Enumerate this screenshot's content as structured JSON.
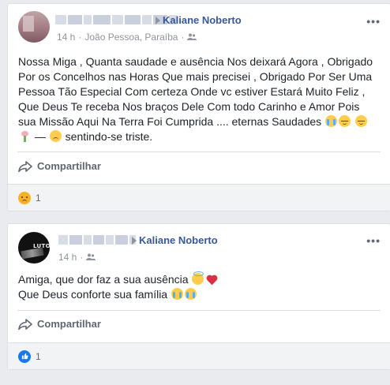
{
  "posts": [
    {
      "author": "Kaliane Noberto",
      "time": "14 h",
      "location": "João Pessoa, Paraíba",
      "more": "•••",
      "text": {
        "line_main": "Nossa Miga , Quanta saudade e ausência Nos deixará Agora , Obrigado Por os Concelhos nas Horas Que mais precisei , Obrigado Por Ser Uma Pessoa Tão Especial Com certeza Onde vc estiver Estará Muito Feliz , Que Deus Te receba Nos braços Dele Com todo Carinho e Amor Pois sua Missão Aqui Na Terra Foi Cumprida .... eternas Saudades",
        "feeling_dash": " — ",
        "feeling": " sentindo-se triste."
      },
      "share_label": "Compartilhar",
      "reaction_count": "1",
      "reaction_type": "sad"
    },
    {
      "author": "Kaliane Noberto",
      "time": "14 h",
      "more": "•••",
      "avatar_text": "LUTO",
      "text": {
        "line1": "Amiga, que dor faz a sua ausência",
        "line2": "Que Deus conforte sua família"
      },
      "share_label": "Compartilhar",
      "reaction_count": "1",
      "reaction_type": "like"
    }
  ],
  "colors": {
    "author_link": "#385898",
    "meta": "#90949c",
    "background": "#e9ebee",
    "like_blue": "#1877f2",
    "sad_yellow": "#f7b125"
  }
}
